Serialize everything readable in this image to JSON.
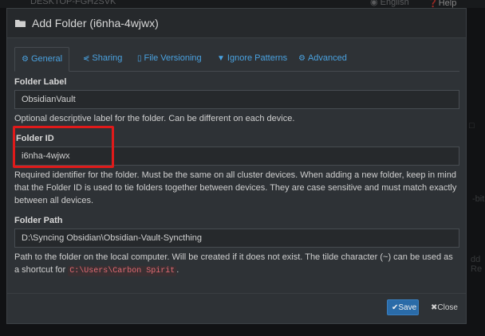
{
  "background": {
    "hostname": "DESKTOP-FGH2SVK",
    "language": "English",
    "help": "Help"
  },
  "dialog": {
    "title": "Add Folder (i6nha-4wjwx)",
    "tabs": [
      {
        "label": "General",
        "icon": "gear-icon",
        "active": true
      },
      {
        "label": "Sharing",
        "icon": "share-icon",
        "active": false
      },
      {
        "label": "File Versioning",
        "icon": "file-icon",
        "active": false
      },
      {
        "label": "Ignore Patterns",
        "icon": "filter-icon",
        "active": false
      },
      {
        "label": "Advanced",
        "icon": "cogs-icon",
        "active": false
      }
    ],
    "folder_label": {
      "label": "Folder Label",
      "value": "ObsidianVault",
      "help": "Optional descriptive label for the folder. Can be different on each device."
    },
    "folder_id": {
      "label": "Folder ID",
      "value": "i6nha-4wjwx",
      "help": "Required identifier for the folder. Must be the same on all cluster devices. When adding a new folder, keep in mind that the Folder ID is used to tie folders together between devices. They are case sensitive and must match exactly between all devices."
    },
    "folder_path": {
      "label": "Folder Path",
      "value": "D:\\Syncing Obsidian\\Obsidian-Vault-Syncthing",
      "help_prefix": "Path to the folder on the local computer. Will be created if it does not exist. The tilde character (~) can be used as a shortcut for",
      "help_code": "C:\\Users\\Carbon Spirit",
      "help_suffix": "."
    },
    "buttons": {
      "save": "Save",
      "close": "Close"
    }
  },
  "colors": {
    "accent": "#4aa2e0",
    "highlight_box": "#e01a1a",
    "save_button": "#2a6ba8"
  }
}
